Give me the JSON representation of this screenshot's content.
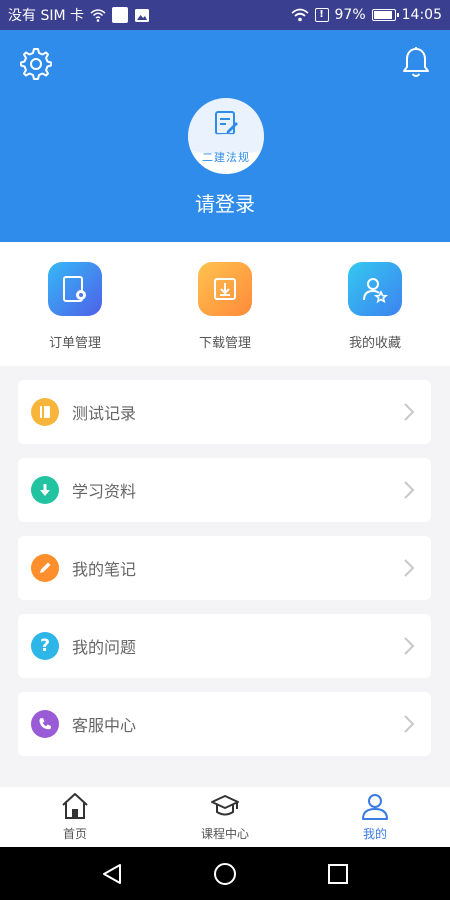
{
  "status_bar": {
    "carrier": "没有 SIM 卡",
    "battery": "97%",
    "time": "14:05"
  },
  "header": {
    "avatar_text": "二建法规",
    "login_text": "请登录"
  },
  "quick_actions": [
    {
      "label": "订单管理",
      "icon": "order-icon",
      "color_from": "#35b8f6",
      "color_to": "#4f60e8"
    },
    {
      "label": "下载管理",
      "icon": "download-box-icon",
      "color_from": "#ffc24e",
      "color_to": "#ff8a3a"
    },
    {
      "label": "我的收藏",
      "icon": "favorite-user-icon",
      "color_from": "#33c8f1",
      "color_to": "#3e82ef"
    }
  ],
  "menu": [
    {
      "label": "测试记录",
      "icon": "book-icon",
      "color": "#f7b63b"
    },
    {
      "label": "学习资料",
      "icon": "download-icon",
      "color": "#22c3a1"
    },
    {
      "label": "我的笔记",
      "icon": "pencil-icon",
      "color": "#ff8f2c"
    },
    {
      "label": "我的问题",
      "icon": "question-icon",
      "color": "#2eb6e9"
    },
    {
      "label": "客服中心",
      "icon": "phone-icon",
      "color": "#9a5bd6"
    }
  ],
  "tabs": [
    {
      "label": "首页",
      "icon": "home-icon",
      "active": false
    },
    {
      "label": "课程中心",
      "icon": "graduation-cap-icon",
      "active": false
    },
    {
      "label": "我的",
      "icon": "user-icon",
      "active": true
    }
  ],
  "colors": {
    "header_blue": "#2f8cea",
    "status_bar": "#3b3f8f",
    "active_tab": "#3a7be5"
  }
}
